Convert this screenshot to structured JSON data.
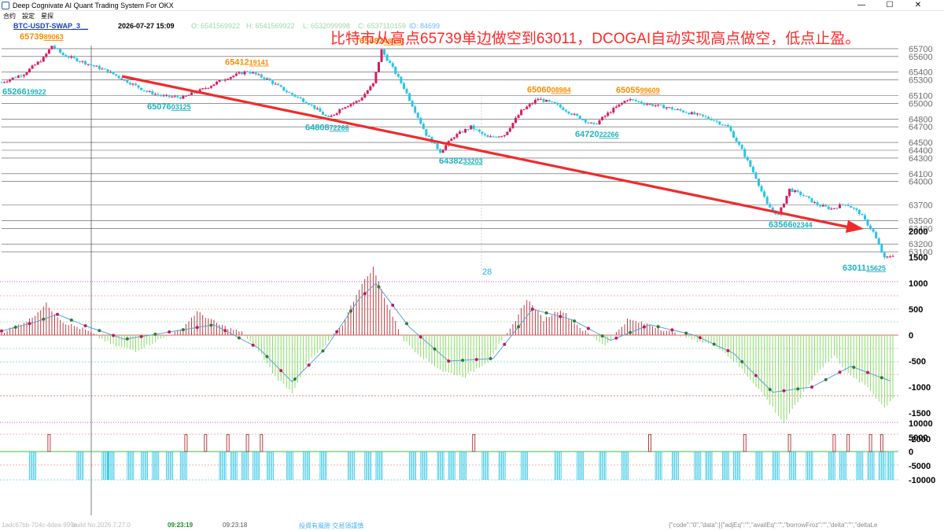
{
  "window": {
    "title": "Deep Cognivate AI Quant Trading System For OKX",
    "minimize_glyph": "—",
    "maximize_glyph": "☐",
    "close_glyph": "✕"
  },
  "menu": [
    "合约",
    "設定",
    "星探"
  ],
  "info": {
    "symbol": "BTC-USDT-SWAP_3__",
    "datetime": "2026-07-27 15:09",
    "open": "O: 6541569922",
    "high": "H: 6541569922",
    "low": "L: 6532099998",
    "close": "C: 6537110159",
    "id": "ID: 84699"
  },
  "headline": "比特市从高点65739单边做空到63011，DCOGAI自动实现高点做空，低点止盈。",
  "colors": {
    "bull": "#d81b60",
    "bear": "#29c5e6",
    "orange": "#ff8c00",
    "teal": "#1fb3c2",
    "arrow": "#ef2b2b",
    "macd_pos": "#b02a30",
    "macd_neg": "#7ed957",
    "signal_line": "#5fa0d8"
  },
  "annotations": [
    {
      "price": "65739",
      "frac": "89063",
      "kind": "high"
    },
    {
      "price": "65266",
      "frac": "19922",
      "kind": "low"
    },
    {
      "price": "65076",
      "frac": "03125",
      "kind": "low"
    },
    {
      "price": "65412",
      "frac": "19141",
      "kind": "high"
    },
    {
      "price": "64808",
      "frac": "72266",
      "kind": "low"
    },
    {
      "price": "65682",
      "frac": "48438",
      "kind": "high"
    },
    {
      "price": "64382",
      "frac": "33203",
      "kind": "low"
    },
    {
      "price": "65060",
      "frac": "08984",
      "kind": "high"
    },
    {
      "price": "64720",
      "frac": "22266",
      "kind": "low"
    },
    {
      "price": "65055",
      "frac": "99609",
      "kind": "high"
    },
    {
      "price": "63566",
      "frac": "02344",
      "kind": "low"
    },
    {
      "price": "63011",
      "frac": "15625",
      "kind": "low"
    }
  ],
  "day_marker": "28",
  "chart_data": {
    "type": "candlestick",
    "title": "",
    "price_axis": {
      "ticks": [
        65700,
        65600,
        65400,
        65300,
        65100,
        65000,
        64800,
        64700,
        64500,
        64400,
        64300,
        64100,
        64000,
        63700,
        63500,
        63400,
        63200,
        63100
      ],
      "range": [
        63000,
        65800
      ]
    },
    "macd_axis": {
      "ticks": [
        2000,
        1500,
        1000,
        500,
        0,
        -500,
        -1000,
        -1500,
        -2000
      ],
      "range": [
        -2200,
        2200
      ]
    },
    "signal_axis": {
      "ticks": [
        10000,
        5000,
        0,
        -5000,
        -10000
      ],
      "range": [
        -11000,
        11000
      ]
    },
    "price_path": [
      [
        0,
        65270
      ],
      [
        8,
        65380
      ],
      [
        15,
        65580
      ],
      [
        18,
        65739
      ],
      [
        22,
        65620
      ],
      [
        30,
        65520
      ],
      [
        38,
        65410
      ],
      [
        45,
        65280
      ],
      [
        52,
        65150
      ],
      [
        58,
        65090
      ],
      [
        65,
        65076
      ],
      [
        72,
        65180
      ],
      [
        80,
        65320
      ],
      [
        88,
        65412
      ],
      [
        95,
        65310
      ],
      [
        102,
        65150
      ],
      [
        110,
        65000
      ],
      [
        117,
        64808
      ],
      [
        122,
        64950
      ],
      [
        128,
        65040
      ],
      [
        133,
        65250
      ],
      [
        136,
        65682
      ],
      [
        140,
        65450
      ],
      [
        144,
        65200
      ],
      [
        148,
        64900
      ],
      [
        152,
        64600
      ],
      [
        157,
        64382
      ],
      [
        162,
        64580
      ],
      [
        168,
        64700
      ],
      [
        174,
        64560
      ],
      [
        180,
        64600
      ],
      [
        186,
        64900
      ],
      [
        192,
        65060
      ],
      [
        198,
        64990
      ],
      [
        205,
        64850
      ],
      [
        212,
        64720
      ],
      [
        218,
        64900
      ],
      [
        224,
        65055
      ],
      [
        230,
        65000
      ],
      [
        238,
        64950
      ],
      [
        246,
        64880
      ],
      [
        254,
        64800
      ],
      [
        260,
        64700
      ],
      [
        265,
        64400
      ],
      [
        270,
        64050
      ],
      [
        274,
        63700
      ],
      [
        278,
        63566
      ],
      [
        282,
        63900
      ],
      [
        287,
        63820
      ],
      [
        292,
        63700
      ],
      [
        297,
        63650
      ],
      [
        302,
        63720
      ],
      [
        307,
        63600
      ],
      [
        312,
        63350
      ],
      [
        316,
        63011
      ],
      [
        319,
        63060
      ]
    ],
    "macd_path": [
      [
        0,
        50
      ],
      [
        10,
        300
      ],
      [
        16,
        600
      ],
      [
        22,
        250
      ],
      [
        30,
        100
      ],
      [
        40,
        -200
      ],
      [
        48,
        -300
      ],
      [
        56,
        -100
      ],
      [
        64,
        100
      ],
      [
        70,
        450
      ],
      [
        78,
        200
      ],
      [
        86,
        50
      ],
      [
        92,
        -300
      ],
      [
        98,
        -800
      ],
      [
        104,
        -1100
      ],
      [
        110,
        -500
      ],
      [
        116,
        -200
      ],
      [
        122,
        200
      ],
      [
        128,
        900
      ],
      [
        133,
        1300
      ],
      [
        138,
        600
      ],
      [
        144,
        -100
      ],
      [
        150,
        -400
      ],
      [
        158,
        -700
      ],
      [
        166,
        -800
      ],
      [
        174,
        -500
      ],
      [
        182,
        100
      ],
      [
        188,
        700
      ],
      [
        194,
        300
      ],
      [
        200,
        500
      ],
      [
        208,
        100
      ],
      [
        216,
        -200
      ],
      [
        224,
        300
      ],
      [
        232,
        200
      ],
      [
        240,
        50
      ],
      [
        248,
        -100
      ],
      [
        256,
        -200
      ],
      [
        264,
        -600
      ],
      [
        272,
        -1100
      ],
      [
        280,
        -1700
      ],
      [
        286,
        -1200
      ],
      [
        292,
        -700
      ],
      [
        298,
        -400
      ],
      [
        304,
        -800
      ],
      [
        310,
        -1000
      ],
      [
        316,
        -1400
      ],
      [
        319,
        -1200
      ]
    ],
    "signal_path": [
      [
        0,
        80
      ],
      [
        12,
        250
      ],
      [
        20,
        400
      ],
      [
        30,
        180
      ],
      [
        44,
        -80
      ],
      [
        60,
        60
      ],
      [
        76,
        200
      ],
      [
        92,
        -250
      ],
      [
        104,
        -900
      ],
      [
        116,
        -250
      ],
      [
        128,
        700
      ],
      [
        134,
        1000
      ],
      [
        146,
        150
      ],
      [
        160,
        -500
      ],
      [
        176,
        -450
      ],
      [
        190,
        500
      ],
      [
        204,
        300
      ],
      [
        218,
        -100
      ],
      [
        232,
        200
      ],
      [
        248,
        0
      ],
      [
        262,
        -350
      ],
      [
        276,
        -1100
      ],
      [
        290,
        -1000
      ],
      [
        304,
        -600
      ],
      [
        319,
        -900
      ]
    ],
    "buy_signals": [
      10,
      27,
      36,
      38,
      45,
      50,
      54,
      59,
      64,
      78,
      82,
      86,
      90,
      95,
      102,
      108,
      114,
      124,
      130,
      134,
      146,
      150,
      156,
      160,
      164,
      172,
      178,
      186,
      198,
      206,
      214,
      222,
      234,
      240,
      248,
      252,
      258,
      262,
      270,
      276,
      282,
      288,
      296,
      300,
      306,
      310,
      314,
      317
    ],
    "sell_signals": [
      17,
      66,
      73,
      81,
      88,
      93,
      169,
      232,
      266,
      282,
      298,
      303,
      311,
      315
    ]
  },
  "status": {
    "session_id": "1adc67bb-704c-4dea-999e-",
    "build": "build No.2026.7.27.0",
    "clock1": "09:23:19",
    "clock2": "09:23:18",
    "risk_note": "投資有風險  交易須謹慎",
    "json_tail": "{\"code\":\"0\",\"data\":[{\"adjEq\":\"\",\"availEq\":\"\",\"borrowFroz\":\"\",\"delta\":\"\",\"deltaLe"
  }
}
